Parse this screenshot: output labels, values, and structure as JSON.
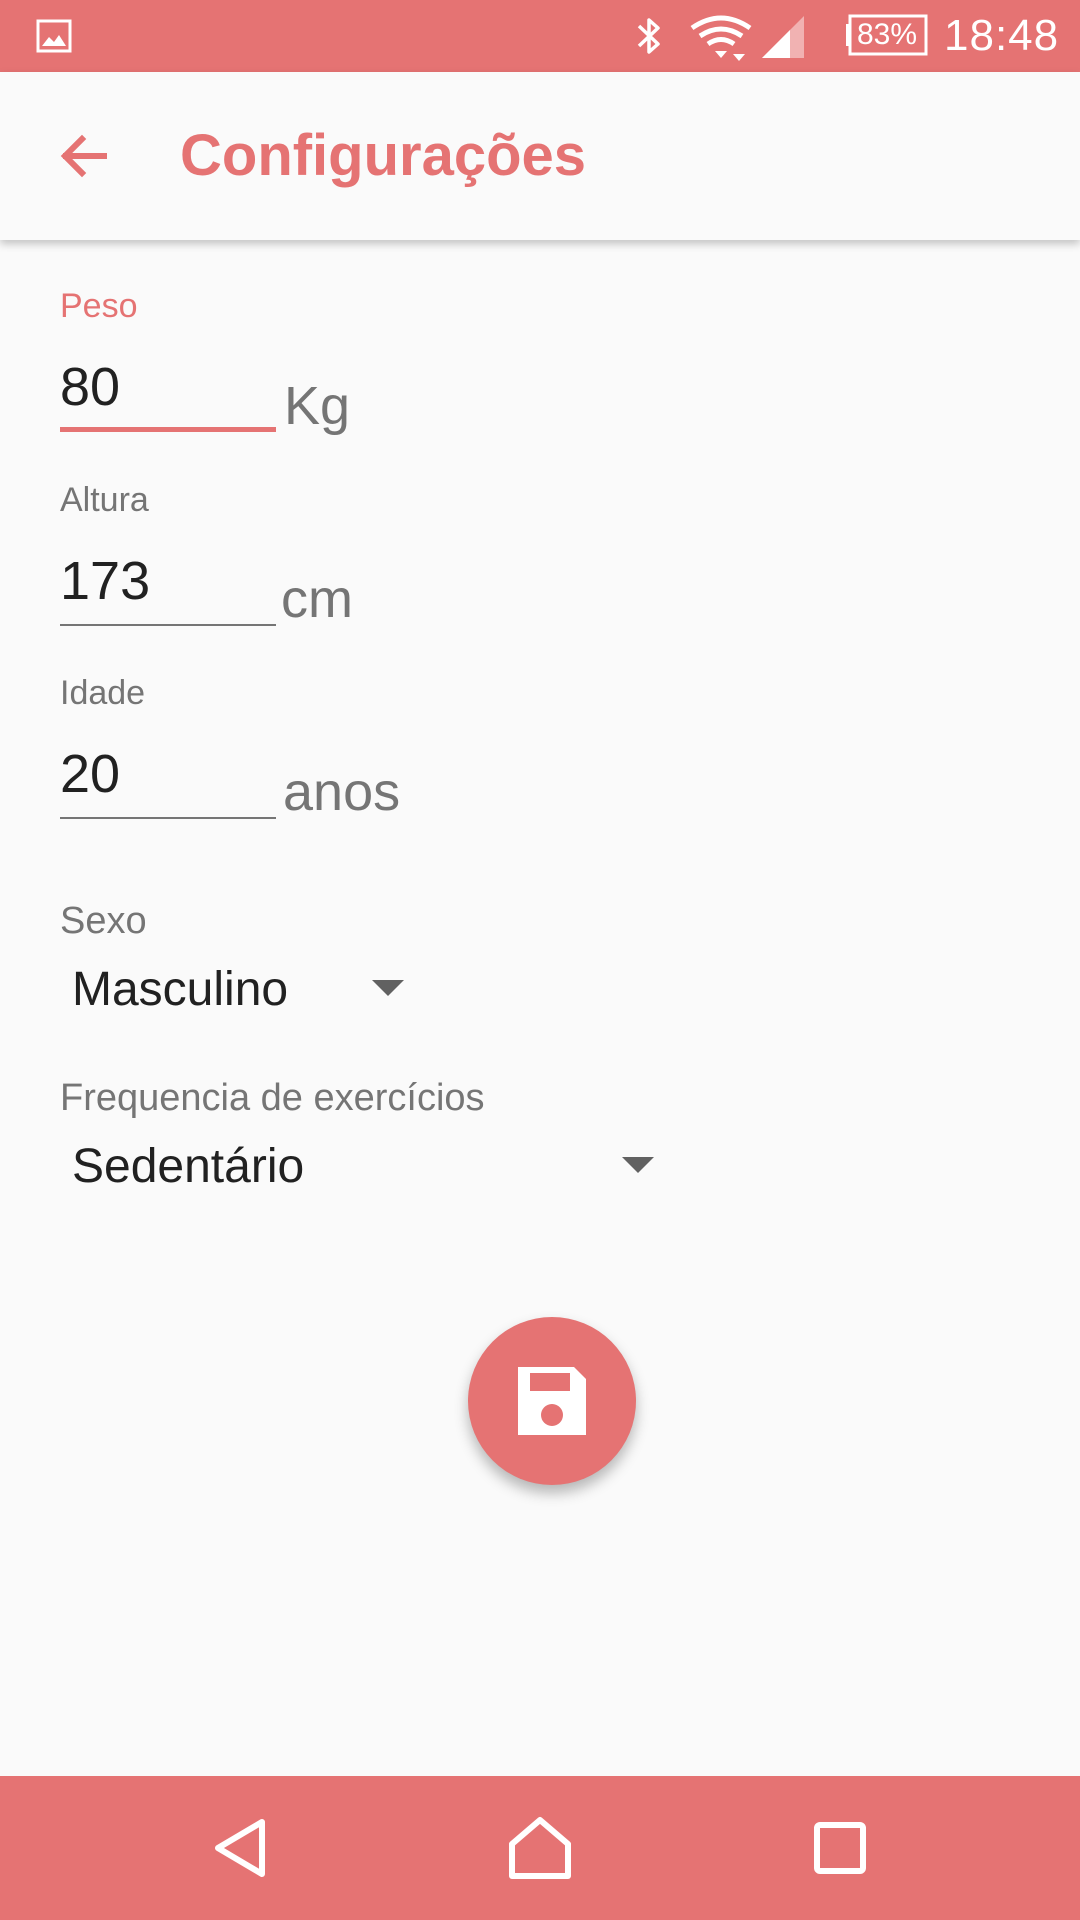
{
  "status_bar": {
    "battery": "83%",
    "time": "18:48",
    "icons": [
      "image-notification-icon",
      "bluetooth-icon",
      "wifi-icon",
      "cell-signal-icon",
      "battery-icon"
    ]
  },
  "app_bar": {
    "title": "Configurações",
    "back_icon": "arrow-back-icon"
  },
  "form": {
    "weight": {
      "label": "Peso",
      "value": "80",
      "unit": "Kg"
    },
    "height": {
      "label": "Altura",
      "value": "173",
      "unit": "cm"
    },
    "age": {
      "label": "Idade",
      "value": "20",
      "unit": "anos"
    },
    "sex": {
      "label": "Sexo",
      "selected": "Masculino"
    },
    "frequency": {
      "label": "Frequencia de exercícios",
      "selected": "Sedentário"
    }
  },
  "fab": {
    "icon": "save-icon"
  },
  "nav_bar": {
    "icons": [
      "back-triangle-icon",
      "home-icon",
      "recents-icon"
    ]
  },
  "colors": {
    "accent": "#e57373",
    "background": "#fafafa",
    "text_primary": "#212121",
    "text_secondary": "#757575"
  }
}
